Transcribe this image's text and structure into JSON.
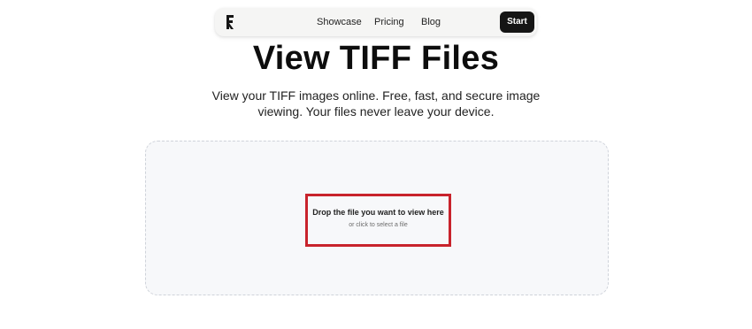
{
  "nav": {
    "logo_icon": "f-logo-icon",
    "links": [
      "Showcase",
      "Pricing",
      "Blog"
    ],
    "start_label": "Start"
  },
  "hero": {
    "title": "View TIFF Files",
    "subtitle": "View your TIFF images online. Free, fast, and secure image viewing. Your files never leave your device."
  },
  "dropzone": {
    "primary_text": "Drop the file you want to view here",
    "secondary_text": "or click to select a file"
  },
  "colors": {
    "start_button_bg": "#151515",
    "highlight_border": "#c8232c",
    "dropzone_bg": "#f7f8fa"
  }
}
